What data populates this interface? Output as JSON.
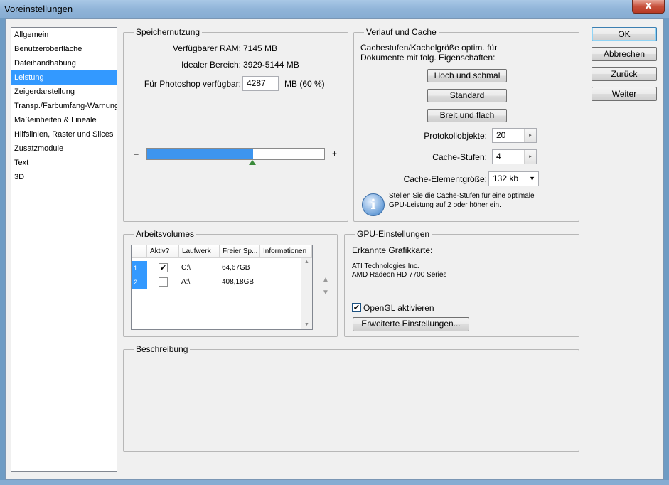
{
  "window": {
    "title": "Voreinstellungen",
    "close_glyph": "x"
  },
  "nav": {
    "items": [
      {
        "label": "Allgemein",
        "selected": false
      },
      {
        "label": "Benutzeroberfläche",
        "selected": false
      },
      {
        "label": "Dateihandhabung",
        "selected": false
      },
      {
        "label": "Leistung",
        "selected": true
      },
      {
        "label": "Zeigerdarstellung",
        "selected": false
      },
      {
        "label": "Transp./Farbumfang-Warnung",
        "selected": false
      },
      {
        "label": "Maßeinheiten & Lineale",
        "selected": false
      },
      {
        "label": "Hilfslinien, Raster und Slices",
        "selected": false
      },
      {
        "label": "Zusatzmodule",
        "selected": false
      },
      {
        "label": "Text",
        "selected": false
      },
      {
        "label": "3D",
        "selected": false
      }
    ]
  },
  "memory": {
    "legend": "Speichernutzung",
    "available_label": "Verfügbarer RAM:",
    "available_value": "7145 MB",
    "ideal_label": "Idealer Bereich:",
    "ideal_value": "3929-5144 MB",
    "photoshop_label": "Für Photoshop verfügbar:",
    "photoshop_value": "4287",
    "photoshop_unit": "MB (60 %)",
    "minus": "–",
    "plus": "+",
    "slider_fraction": 0.6
  },
  "cache": {
    "legend": "Verlauf und Cache",
    "description": "Cachestufen/Kachelgröße optim. für Dokumente mit folg. Eigenschaften:",
    "btn_tall_thin": "Hoch und schmal",
    "btn_default": "Standard",
    "btn_big_flat": "Breit und flach",
    "history_label": "Protokollobjekte:",
    "history_value": "20",
    "levels_label": "Cache-Stufen:",
    "levels_value": "4",
    "tile_label": "Cache-Elementgröße:",
    "tile_value": "132 kb",
    "info_text": "Stellen Sie die Cache-Stufen für eine optimale GPU-Leistung auf 2 oder höher ein.",
    "info_glyph": "i"
  },
  "volumes": {
    "legend": "Arbeitsvolumes",
    "columns": [
      "Aktiv?",
      "Laufwerk",
      "Freier Sp...",
      "Informationen"
    ],
    "rows": [
      {
        "num": "1",
        "active": true,
        "drive": "C:\\",
        "free": "64,67GB",
        "info": ""
      },
      {
        "num": "2",
        "active": false,
        "drive": "A:\\",
        "free": "408,18GB",
        "info": ""
      }
    ],
    "up_glyph": "▲",
    "down_glyph": "▼",
    "check_glyph": "✔"
  },
  "gpu": {
    "legend": "GPU-Einstellungen",
    "detected_label": "Erkannte Grafikkarte:",
    "vendor": "ATI Technologies Inc.",
    "model": "AMD Radeon HD 7700 Series",
    "opengl_label": "OpenGL aktivieren",
    "opengl_checked": true,
    "advanced_button": "Erweiterte Einstellungen..."
  },
  "description": {
    "legend": "Beschreibung"
  },
  "actions": {
    "ok": "OK",
    "cancel": "Abbrechen",
    "back": "Zurück",
    "next": "Weiter"
  }
}
